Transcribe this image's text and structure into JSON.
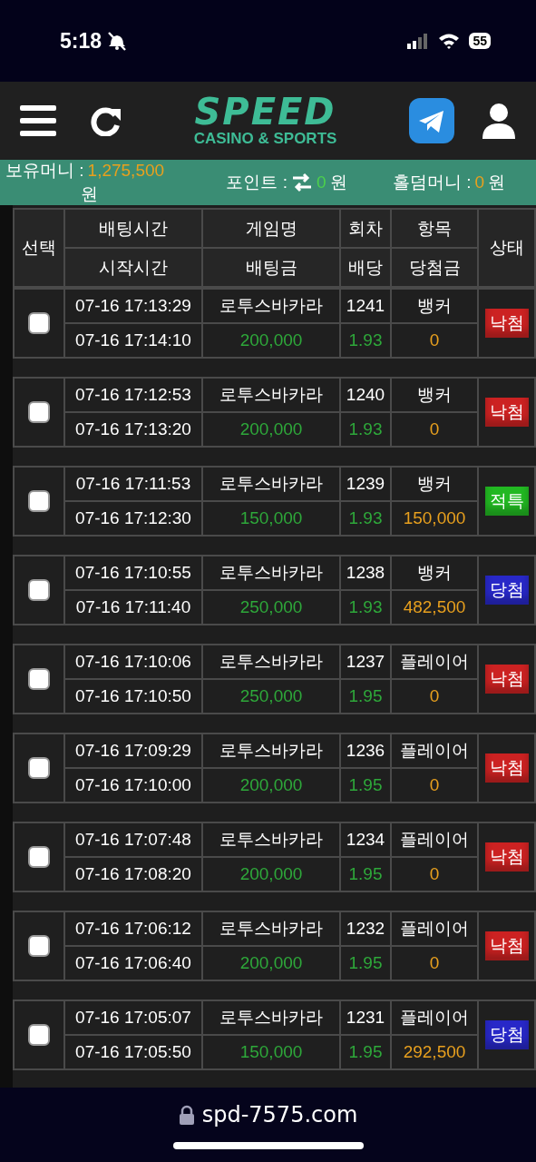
{
  "status_bar": {
    "time": "5:18",
    "battery": "55"
  },
  "header": {
    "logo": "SPEED",
    "logo_subtitle": "CASINO & SPORTS"
  },
  "balances": [
    {
      "label": "보유머니 :",
      "value": "1,275,500",
      "unit": "원",
      "color": "#e8a01e",
      "kind": "money"
    },
    {
      "label": "포인트 :",
      "value": "0",
      "unit": "원",
      "color": "#4cd04c",
      "kind": "transfer"
    },
    {
      "label": "홀덤머니 :",
      "value": "0",
      "unit": "원",
      "color": "#e8a01e",
      "kind": "money"
    }
  ],
  "table": {
    "columns": {
      "select": "선택",
      "bet_time": "배팅시간",
      "start_time": "시작시간",
      "game": "게임명",
      "bet_amount": "배팅금",
      "round": "회차",
      "odds": "배당",
      "pick": "항목",
      "payout": "당첨금",
      "status": "상태"
    },
    "rows": [
      {
        "checked": false,
        "bet_time": "07-16 17:13:29",
        "start_time": "07-16 17:14:10",
        "game": "로투스바카라",
        "amount": "200,000",
        "round": "1241",
        "odds": "1.93",
        "pick": "뱅커",
        "payout": "0",
        "status": "낙첨",
        "color": "#cc2222"
      },
      {
        "checked": false,
        "bet_time": "07-16 17:12:53",
        "start_time": "07-16 17:13:20",
        "game": "로투스바카라",
        "amount": "200,000",
        "round": "1240",
        "odds": "1.93",
        "pick": "뱅커",
        "payout": "0",
        "status": "낙첨",
        "color": "#cc2222"
      },
      {
        "checked": false,
        "bet_time": "07-16 17:11:53",
        "start_time": "07-16 17:12:30",
        "game": "로투스바카라",
        "amount": "150,000",
        "round": "1239",
        "odds": "1.93",
        "pick": "뱅커",
        "payout": "150,000",
        "status": "적특",
        "color": "#22b822"
      },
      {
        "checked": false,
        "bet_time": "07-16 17:10:55",
        "start_time": "07-16 17:11:40",
        "game": "로투스바카라",
        "amount": "250,000",
        "round": "1238",
        "odds": "1.93",
        "pick": "뱅커",
        "payout": "482,500",
        "status": "당첨",
        "color": "#2828c8"
      },
      {
        "checked": false,
        "bet_time": "07-16 17:10:06",
        "start_time": "07-16 17:10:50",
        "game": "로투스바카라",
        "amount": "250,000",
        "round": "1237",
        "odds": "1.95",
        "pick": "플레이어",
        "payout": "0",
        "status": "낙첨",
        "color": "#cc2222"
      },
      {
        "checked": false,
        "bet_time": "07-16 17:09:29",
        "start_time": "07-16 17:10:00",
        "game": "로투스바카라",
        "amount": "200,000",
        "round": "1236",
        "odds": "1.95",
        "pick": "플레이어",
        "payout": "0",
        "status": "낙첨",
        "color": "#cc2222"
      },
      {
        "checked": false,
        "bet_time": "07-16 17:07:48",
        "start_time": "07-16 17:08:20",
        "game": "로투스바카라",
        "amount": "200,000",
        "round": "1234",
        "odds": "1.95",
        "pick": "플레이어",
        "payout": "0",
        "status": "낙첨",
        "color": "#cc2222"
      },
      {
        "checked": false,
        "bet_time": "07-16 17:06:12",
        "start_time": "07-16 17:06:40",
        "game": "로투스바카라",
        "amount": "200,000",
        "round": "1232",
        "odds": "1.95",
        "pick": "플레이어",
        "payout": "0",
        "status": "낙첨",
        "color": "#cc2222"
      },
      {
        "checked": false,
        "bet_time": "07-16 17:05:07",
        "start_time": "07-16 17:05:50",
        "game": "로투스바카라",
        "amount": "150,000",
        "round": "1231",
        "odds": "1.95",
        "pick": "플레이어",
        "payout": "292,500",
        "status": "당첨",
        "color": "#2828c8"
      }
    ]
  },
  "url_bar": {
    "address": "spd-7575.com"
  }
}
